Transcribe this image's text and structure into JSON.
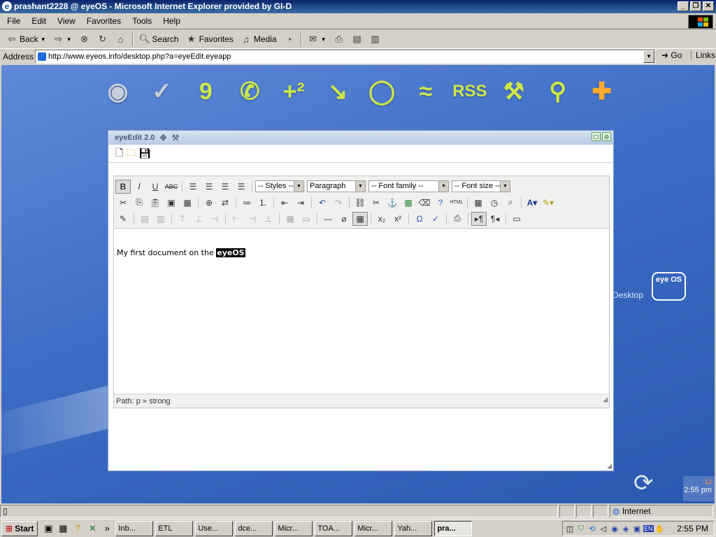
{
  "browser": {
    "title": "prashant2228 @ eyeOS - Microsoft Internet Explorer provided by GI-D",
    "menu": [
      "File",
      "Edit",
      "View",
      "Favorites",
      "Tools",
      "Help"
    ],
    "toolbar": {
      "back": "Back",
      "search": "Search",
      "favorites": "Favorites",
      "media": "Media"
    },
    "address_label": "Address",
    "url": "http://www.eyeos.info/desktop.php?a=eyeEdit.eyeapp",
    "go": "Go",
    "links": "Links"
  },
  "desktop": {
    "dock_icons": [
      "home-icon",
      "edit-check-icon",
      "calendar-icon",
      "phone-icon",
      "calculator-icon",
      "pointer-icon",
      "chat-bubble-icon",
      "waves-icon",
      "rss-icon",
      "wrench-icon",
      "pin-icon",
      "plus-icon"
    ],
    "dock_rss_text": "RSS",
    "logo_text": "eye OS",
    "label": "Desktop",
    "clock": "2:55 pm"
  },
  "app": {
    "title": "eyeEdit 2.0",
    "styles_select": "-- Styles --",
    "format_select": "Paragraph",
    "font_family_select": "-- Font family --",
    "font_size_select": "-- Font size --",
    "html_button": "HTML",
    "content_text": "My first document on the ",
    "content_bold": "eyeOS",
    "path_label": "Path:",
    "path_value": "p » strong"
  },
  "statusbar": {
    "zone": "Internet"
  },
  "taskbar": {
    "start": "Start",
    "tasks": [
      "Inb...",
      "ETL",
      "Use...",
      "dce...",
      "Micr...",
      "TOA...",
      "Micr...",
      "Yah...",
      "pra..."
    ],
    "tray_lang": "EN",
    "time": "2:55 PM"
  },
  "colors": {
    "accent_green": "#cde64a",
    "accent_orange": "#ffab2e",
    "titlebar": "#0a246a"
  }
}
